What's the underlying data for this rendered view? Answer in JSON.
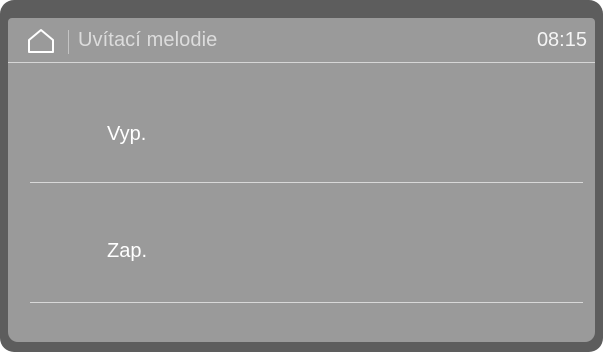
{
  "header": {
    "home_icon": "home-icon",
    "title": "Uvítací melodie",
    "time": "08:15"
  },
  "options": [
    {
      "label": "Vyp."
    },
    {
      "label": "Zap."
    }
  ],
  "colors": {
    "bezel": "#5d5d5d",
    "screen": "#9a9a9a",
    "text": "#ffffff",
    "divider": "#d8d8d8"
  }
}
